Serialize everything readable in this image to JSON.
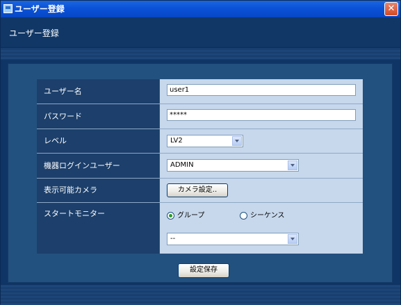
{
  "window": {
    "title": "ユーザー登録",
    "close_glyph": "✕"
  },
  "header": {
    "title": "ユーザー登録"
  },
  "form": {
    "username": {
      "label": "ユーザー名",
      "value": "user1"
    },
    "password": {
      "label": "パスワード",
      "value": "*****"
    },
    "level": {
      "label": "レベル",
      "value": "LV2"
    },
    "device_login_user": {
      "label": "機器ログインユーザー",
      "value": "ADMIN"
    },
    "visible_cameras": {
      "label": "表示可能カメラ",
      "button": "カメラ設定.."
    },
    "start_monitor": {
      "label": "スタートモニター",
      "option_group": "グループ",
      "option_sequence": "シーケンス",
      "selected": "グループ",
      "select_value": "--"
    }
  },
  "actions": {
    "save": "設定保存"
  },
  "icons": {
    "app": "app-window-icon",
    "close": "close-icon",
    "dropdown": "chevron-down-icon"
  }
}
